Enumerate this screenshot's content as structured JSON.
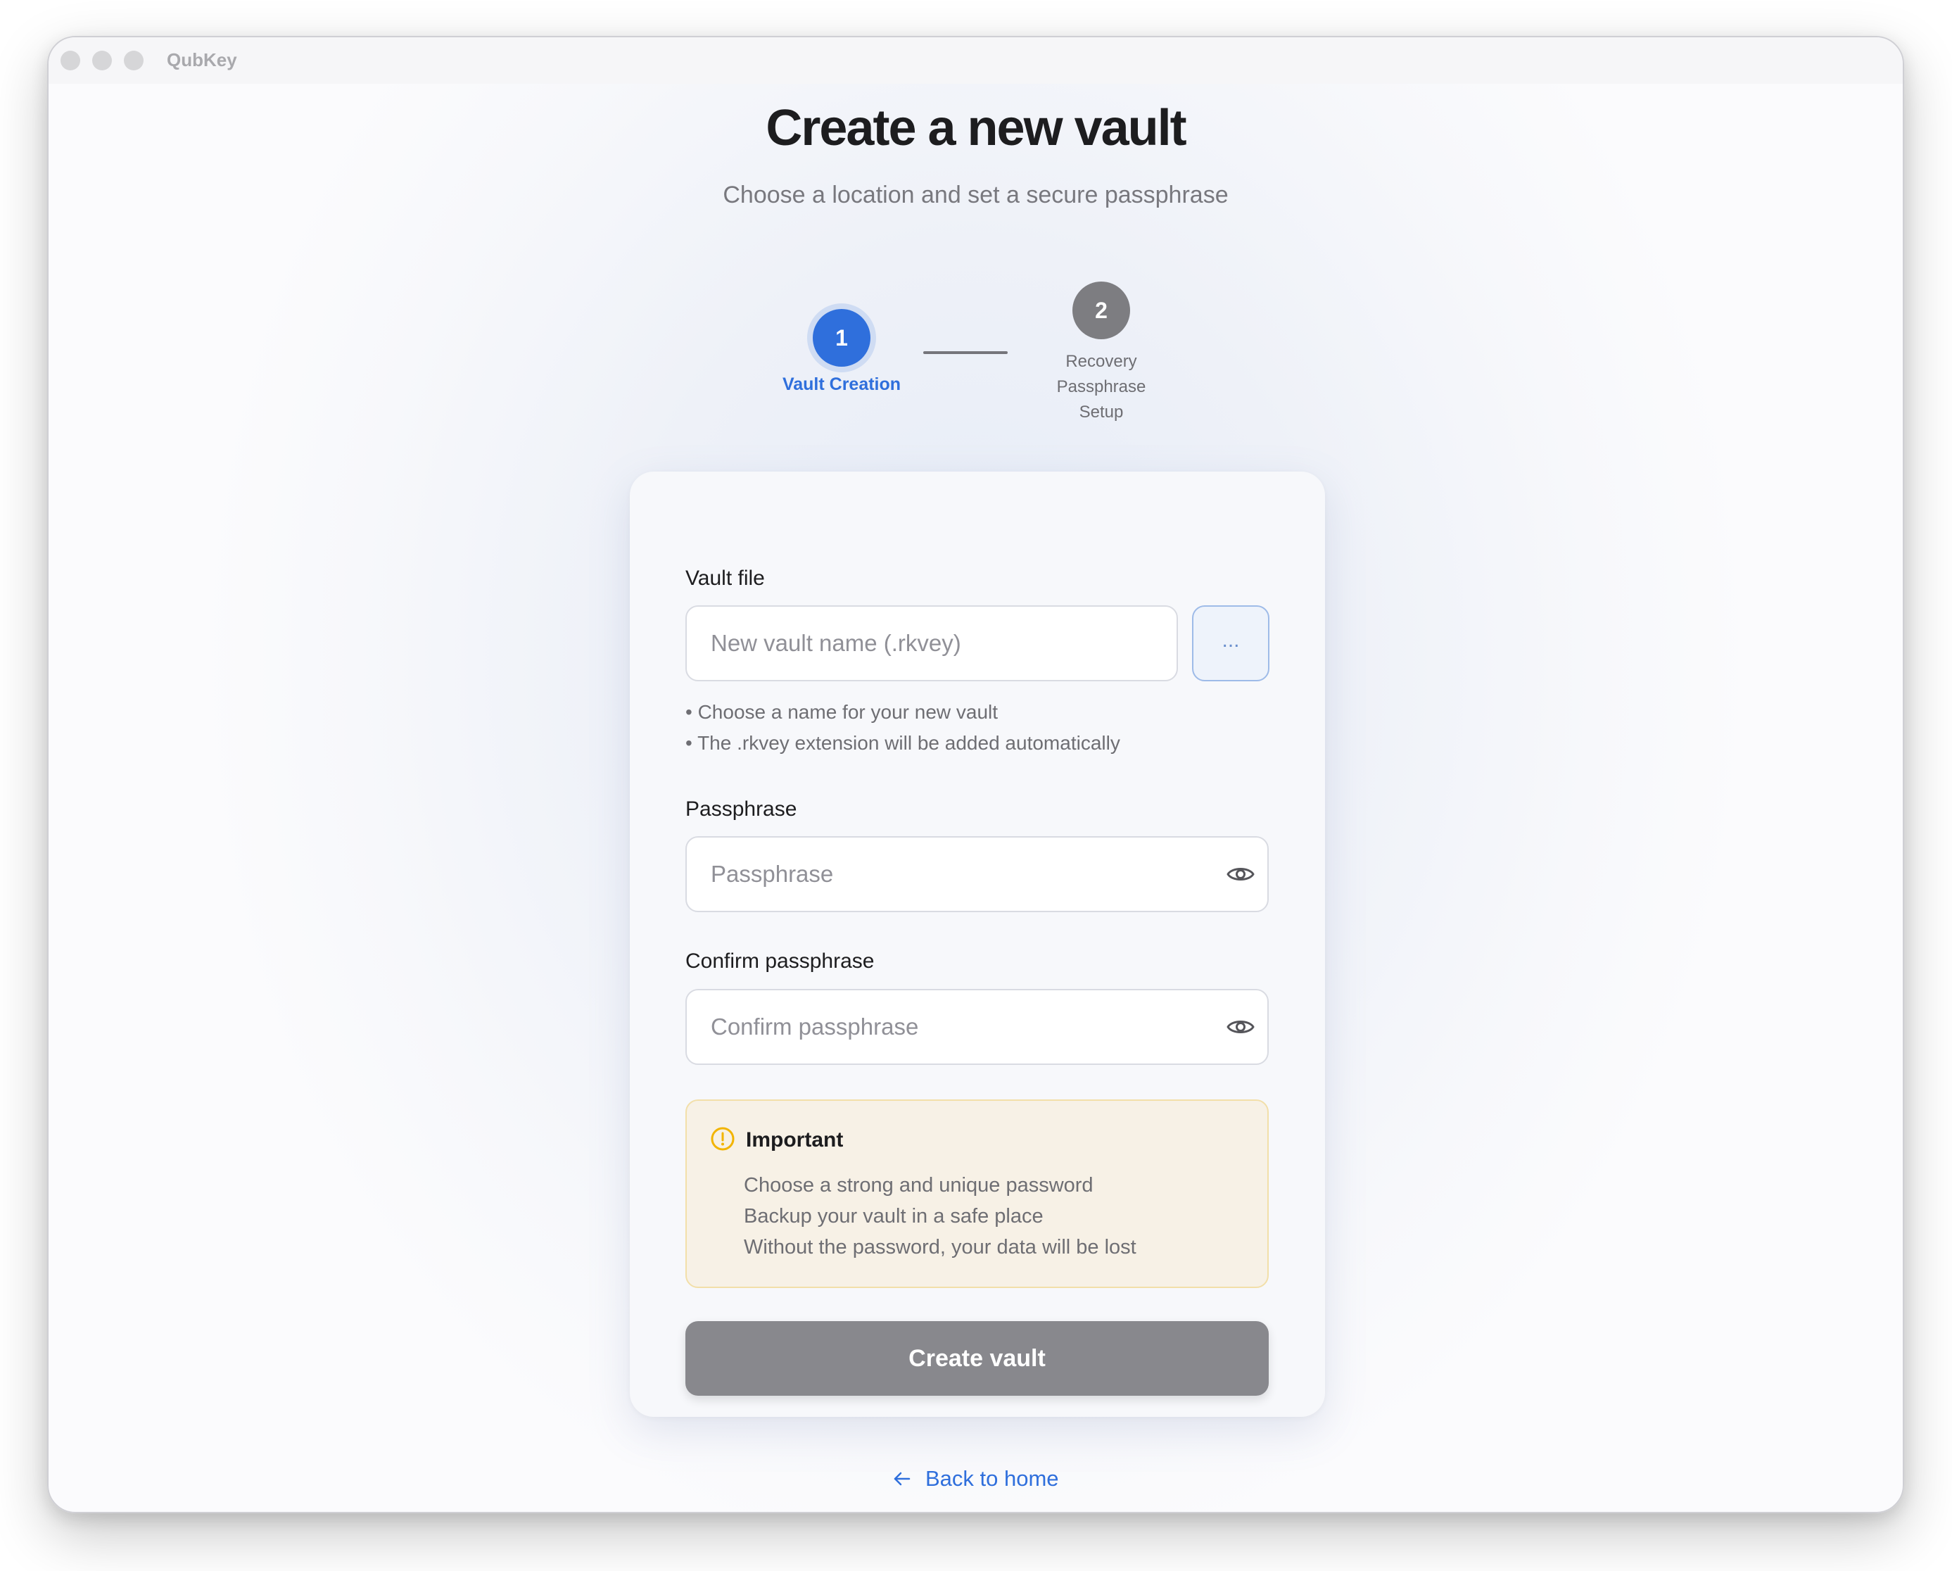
{
  "window": {
    "app_title": "QubKey"
  },
  "header": {
    "title": "Create a new vault",
    "subtitle": "Choose a location and set a secure passphrase"
  },
  "stepper": {
    "steps": [
      {
        "number": "1",
        "label": "Vault Creation",
        "state": "active"
      },
      {
        "number": "2",
        "label_lines": [
          "Recovery",
          "Passphrase",
          "Setup"
        ],
        "state": "pending"
      }
    ]
  },
  "form": {
    "vault_file": {
      "label": "Vault file",
      "placeholder": "New vault name (.rkvey)",
      "value": "",
      "browse_label": "...",
      "hints": [
        "• Choose a name for your new vault",
        "• The .rkvey extension will be added automatically"
      ]
    },
    "passphrase": {
      "label": "Passphrase",
      "placeholder": "Passphrase",
      "value": ""
    },
    "confirm": {
      "label": "Confirm passphrase",
      "placeholder": "Confirm passphrase",
      "value": ""
    },
    "notice": {
      "title": "Important",
      "lines": [
        "Choose a strong and unique password",
        "Backup your vault in a safe place",
        "Without the password, your data will be lost"
      ]
    },
    "submit_label": "Create vault"
  },
  "footer": {
    "back_label": "Back to home"
  },
  "colors": {
    "accent": "#2f6fdc",
    "disabled_button": "#88888d",
    "notice_background": "#f7f1e6",
    "notice_icon": "#f2b400"
  },
  "icons": [
    "eye-icon",
    "warning-circle-icon",
    "arrow-left-icon"
  ]
}
